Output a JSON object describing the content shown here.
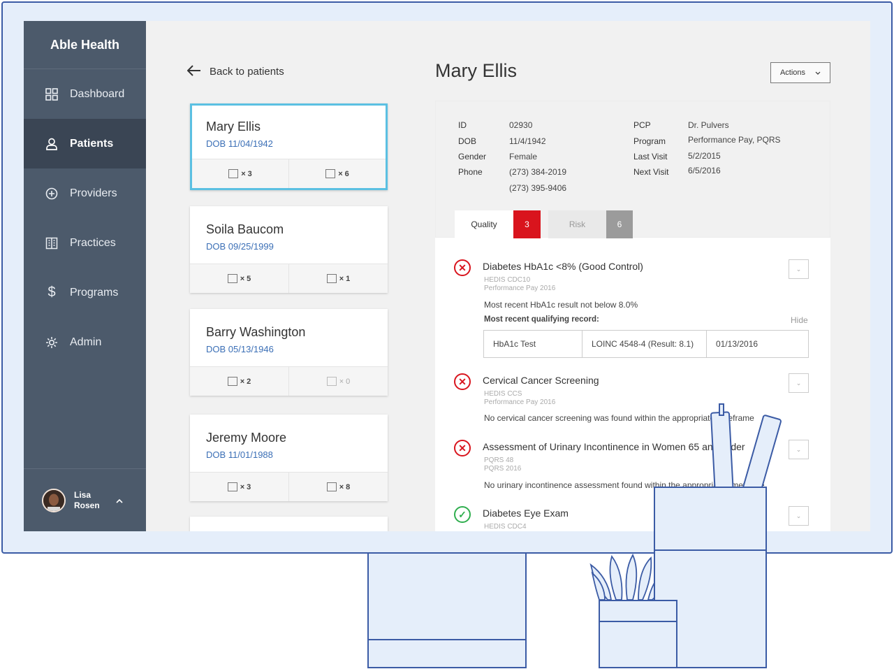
{
  "brand": "Able Health",
  "nav": [
    {
      "label": "Dashboard",
      "icon": "dashboard-icon"
    },
    {
      "label": "Patients",
      "icon": "person-icon",
      "active": true
    },
    {
      "label": "Providers",
      "icon": "plus-circle-icon"
    },
    {
      "label": "Practices",
      "icon": "building-icon"
    },
    {
      "label": "Programs",
      "icon": "dollar-icon"
    },
    {
      "label": "Admin",
      "icon": "gear-icon"
    }
  ],
  "user": {
    "first": "Lisa",
    "last": "Rosen"
  },
  "back_label": "Back to patients",
  "patients": [
    {
      "name": "Mary Ellis",
      "dob": "DOB 11/04/1942",
      "quality": "× 3",
      "risk": "× 6"
    },
    {
      "name": "Soila Baucom",
      "dob": "DOB 09/25/1999",
      "quality": "× 5",
      "risk": "× 1"
    },
    {
      "name": "Barry Washington",
      "dob": "DOB 05/13/1946",
      "quality": "× 2",
      "risk": "× 0"
    },
    {
      "name": "Jeremy Moore",
      "dob": "DOB 11/01/1988",
      "quality": "× 3",
      "risk": "× 8"
    }
  ],
  "detail": {
    "title": "Mary Ellis",
    "actions_label": "Actions",
    "labels": {
      "id": "ID",
      "dob": "DOB",
      "gender": "Gender",
      "phone": "Phone",
      "pcp": "PCP",
      "program": "Program",
      "last_visit": "Last Visit",
      "next_visit": "Next Visit"
    },
    "values": {
      "id": "02930",
      "dob": "11/4/1942",
      "gender": "Female",
      "phone1": "(273) 384-2019",
      "phone2": "(273) 395-9406",
      "pcp": "Dr. Pulvers",
      "program": "Performance Pay, PQRS",
      "last_visit": "5/2/2015",
      "next_visit": "6/5/2016"
    },
    "tabs": {
      "quality": "Quality",
      "quality_count": "3",
      "risk": "Risk",
      "risk_count": "6"
    },
    "measures": [
      {
        "title": "Diabetes HbA1c <8% (Good Control)",
        "sub1": "HEDIS CDC10",
        "sub2": "Performance Pay 2016",
        "text": "Most recent HbA1c result not below 8.0%",
        "record_label": "Most recent qualifying record:",
        "hide": "Hide",
        "record": [
          "HbA1c Test",
          "LOINC 4548-4 (Result: 8.1)",
          "01/13/2016"
        ],
        "status": "fail"
      },
      {
        "title": "Cervical Cancer Screening",
        "sub1": "HEDIS CCS",
        "sub2": "Performance Pay 2016",
        "text": "No cervical cancer screening was found within the appropriate timeframe",
        "status": "fail"
      },
      {
        "title": "Assessment of Urinary Incontinence in Women 65 and Older",
        "sub1": "PQRS 48",
        "sub2": "PQRS 2016",
        "text": "No urinary incontinence assessment found within the appropriate timeframe",
        "status": "fail"
      },
      {
        "title": "Diabetes Eye Exam",
        "sub1": "HEDIS CDC4",
        "status": "pass"
      }
    ]
  },
  "colors": {
    "sidebar": "#4c5a6b",
    "accent": "#3b6fb6",
    "alert": "#d9141d",
    "ok": "#2fae4e",
    "illustration": "#3b5ba5"
  }
}
